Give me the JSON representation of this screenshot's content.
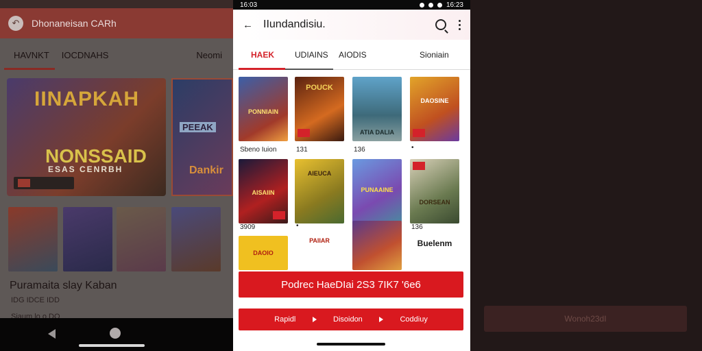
{
  "left_app": {
    "title": "Dhonaneisan CARh",
    "tabs": [
      "HAVNKT",
      "IOCDNAHS"
    ],
    "tab_right": "Neomi",
    "hero_line1": "IINAPKAH",
    "hero_line2": "NONSSAID",
    "hero_line3": "ESAS CENRBH",
    "hero2_text": "PEEAK",
    "hero2_text2": "Dankir",
    "section_title": "Puramaita slay Kaban",
    "section_sub": "IDG IDCE IDD",
    "section_sub2": "Siaum lo o DO"
  },
  "status_bar": {
    "time_left": "16:03",
    "time_right": "16:23"
  },
  "header": {
    "back_icon": "back-arrow-icon",
    "title": "IIundandisiu.",
    "search_icon": "search-icon",
    "more_icon": "more-vertical-icon"
  },
  "tabs": [
    {
      "label": "HAEK",
      "active": true
    },
    {
      "label": "UDIAINS",
      "active": false
    },
    {
      "label": "AIODIS",
      "active": false
    },
    {
      "label": "Sioniain",
      "active": false
    }
  ],
  "grid": {
    "row1": [
      {
        "label": "PONNIAIN",
        "caption": "Sbeno Iuion"
      },
      {
        "label": "POUCK",
        "caption": "131"
      },
      {
        "label": "ATIA DALIA",
        "caption": "136"
      },
      {
        "label": "DAOSINE",
        "caption": "•"
      }
    ],
    "row2": [
      {
        "label": "AISAIIN",
        "caption": "3909"
      },
      {
        "label": "AIEUCA",
        "caption": "•"
      },
      {
        "label": "PUNAAINE",
        "caption": ""
      },
      {
        "label": "DORSEAN",
        "caption": "136"
      }
    ],
    "row3": [
      {
        "label": "DAOIO",
        "caption": ""
      },
      {
        "label": "PAIIAR",
        "caption": ""
      },
      {
        "label": "",
        "caption": ""
      },
      {
        "label": "Buelenm",
        "caption": ""
      }
    ]
  },
  "primary_button": "Podrec HaeDIai 2S3 7IK7 '6e6",
  "action_bar": {
    "item1": "Rapidl",
    "item2": "Disoidon",
    "item3": "Coddiuy"
  },
  "right_button": "Wonoh23dI",
  "colors": {
    "accent": "#d9191f",
    "tab_active": "#d4222a"
  }
}
